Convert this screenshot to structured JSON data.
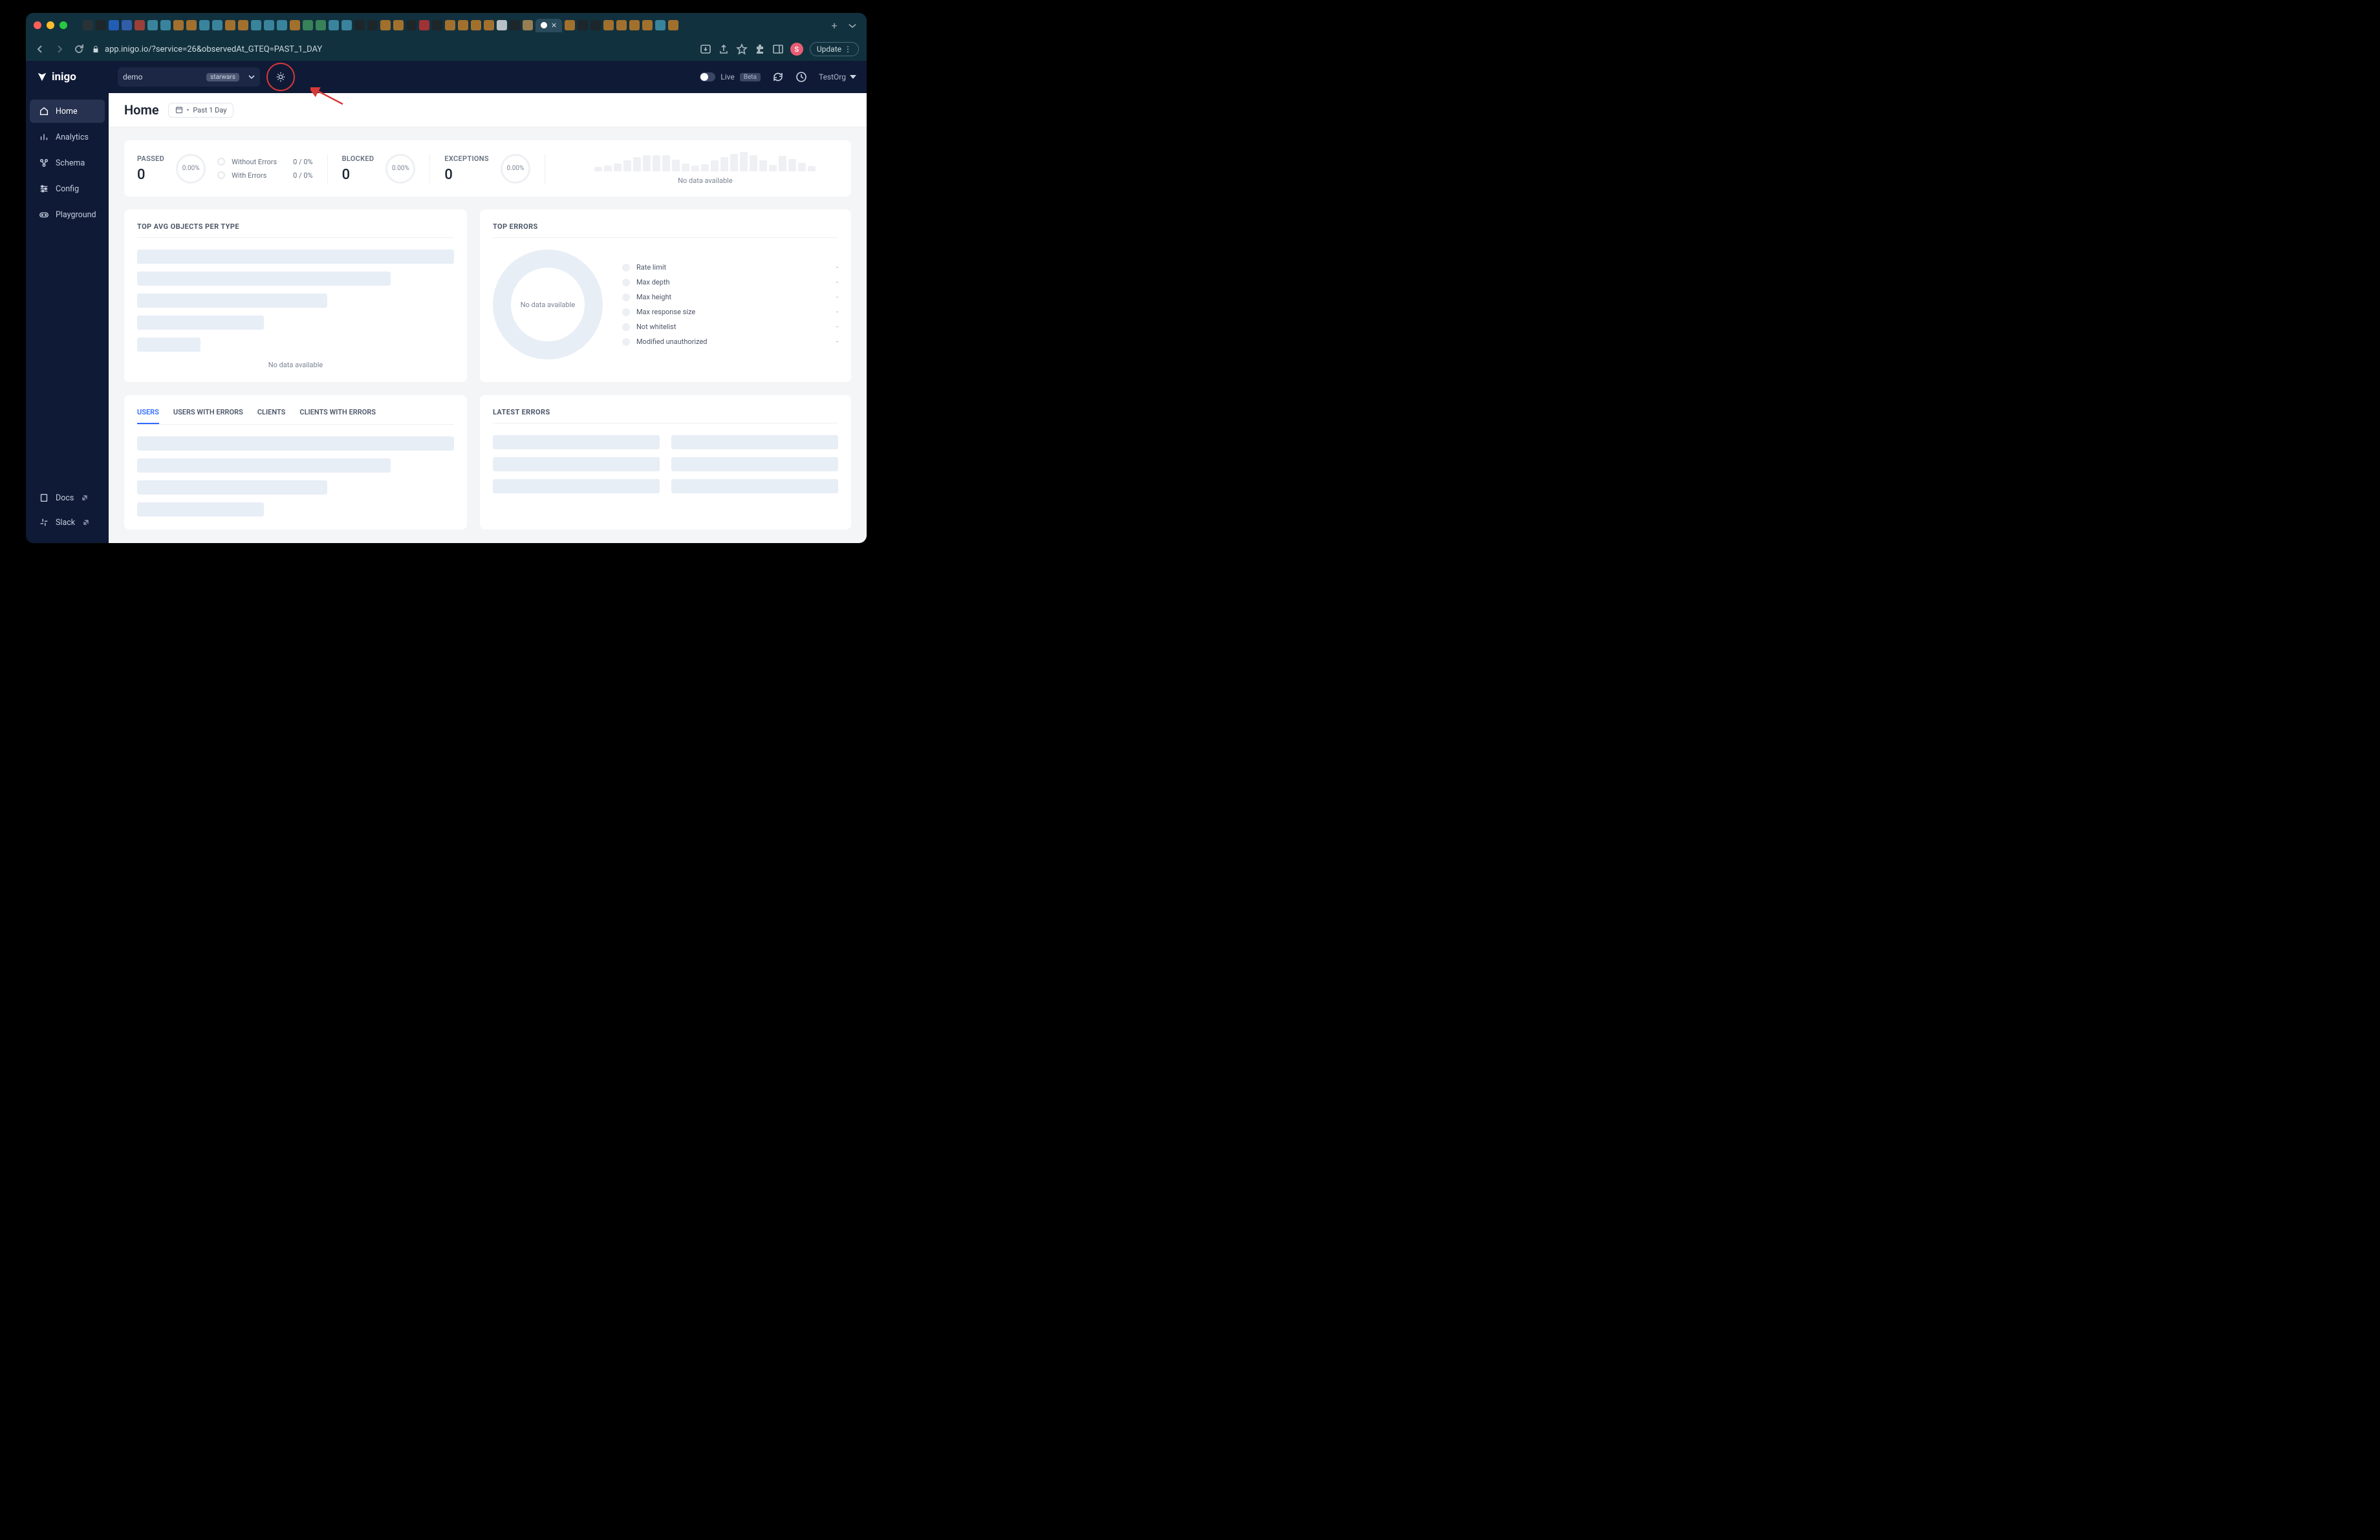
{
  "browser": {
    "url": "app.inigo.io/?service=26&observedAt_GTEQ=PAST_1_DAY",
    "update_label": "Update",
    "avatar_letter": "S"
  },
  "header": {
    "brand": "inigo",
    "service_name": "demo",
    "service_tag": "starwars",
    "live_label": "Live",
    "beta_label": "Beta",
    "org_label": "TestOrg"
  },
  "sidebar": {
    "items": [
      {
        "label": "Home"
      },
      {
        "label": "Analytics"
      },
      {
        "label": "Schema"
      },
      {
        "label": "Config"
      },
      {
        "label": "Playground"
      }
    ],
    "bottom": [
      {
        "label": "Docs"
      },
      {
        "label": "Slack"
      }
    ]
  },
  "page": {
    "title": "Home",
    "date_range": "Past 1 Day"
  },
  "stats": {
    "passed": {
      "title": "PASSED",
      "value": "0",
      "percent": "0.00%"
    },
    "passed_sub": [
      {
        "label": "Without Errors",
        "value": "0 / 0%"
      },
      {
        "label": "With Errors",
        "value": "0 / 0%"
      }
    ],
    "blocked": {
      "title": "BLOCKED",
      "value": "0",
      "percent": "0.00%"
    },
    "exceptions": {
      "title": "EXCEPTIONS",
      "value": "0",
      "percent": "0.00%"
    },
    "sparkline_nodata": "No data available"
  },
  "panels": {
    "top_objects_title": "TOP AVG OBJECTS PER TYPE",
    "top_objects_nodata": "No data available",
    "top_errors_title": "TOP ERRORS",
    "top_errors_nodata": "No data available",
    "top_errors_legend": [
      "Rate limit",
      "Max depth",
      "Max height",
      "Max response size",
      "Not whitelist",
      "Modified unauthorized"
    ],
    "tabs": [
      "USERS",
      "USERS WITH ERRORS",
      "CLIENTS",
      "CLIENTS WITH ERRORS"
    ],
    "latest_errors_title": "LATEST ERRORS"
  }
}
